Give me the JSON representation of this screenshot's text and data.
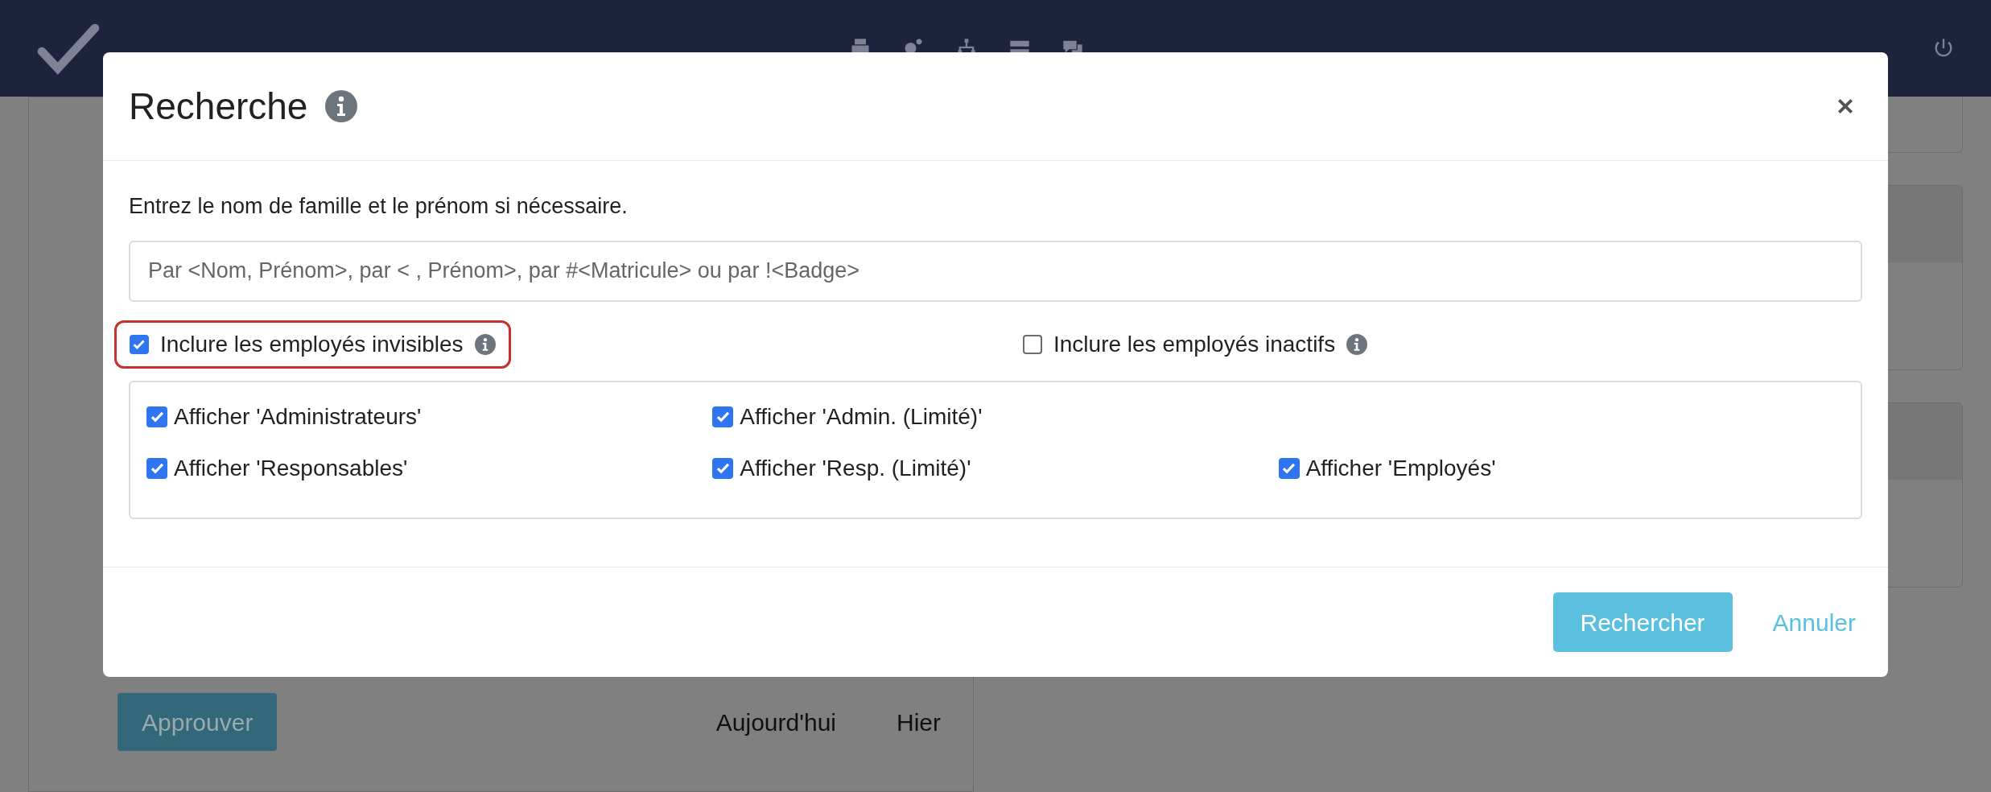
{
  "background": {
    "approve_button": "Approuver",
    "links": [
      "Aujourd'hui",
      "Hier"
    ]
  },
  "modal": {
    "title": "Recherche",
    "instructions": "Entrez le nom de famille et le prénom si nécessaire.",
    "search": {
      "placeholder": "Par <Nom, Prénom>, par < , Prénom>, par #<Matricule> ou par !<Badge>"
    },
    "options": [
      {
        "label": "Inclure les employés invisibles",
        "checked": true,
        "highlighted": true
      },
      {
        "label": "Inclure les employés inactifs",
        "checked": false,
        "highlighted": false
      }
    ],
    "filters": [
      [
        {
          "label": "Afficher 'Administrateurs'",
          "checked": true
        },
        {
          "label": "Afficher 'Admin. (Limité)'",
          "checked": true
        }
      ],
      [
        {
          "label": "Afficher 'Responsables'",
          "checked": true
        },
        {
          "label": "Afficher 'Resp. (Limité)'",
          "checked": true
        },
        {
          "label": "Afficher 'Employés'",
          "checked": true
        }
      ]
    ],
    "buttons": {
      "search": "Rechercher",
      "cancel": "Annuler"
    }
  }
}
